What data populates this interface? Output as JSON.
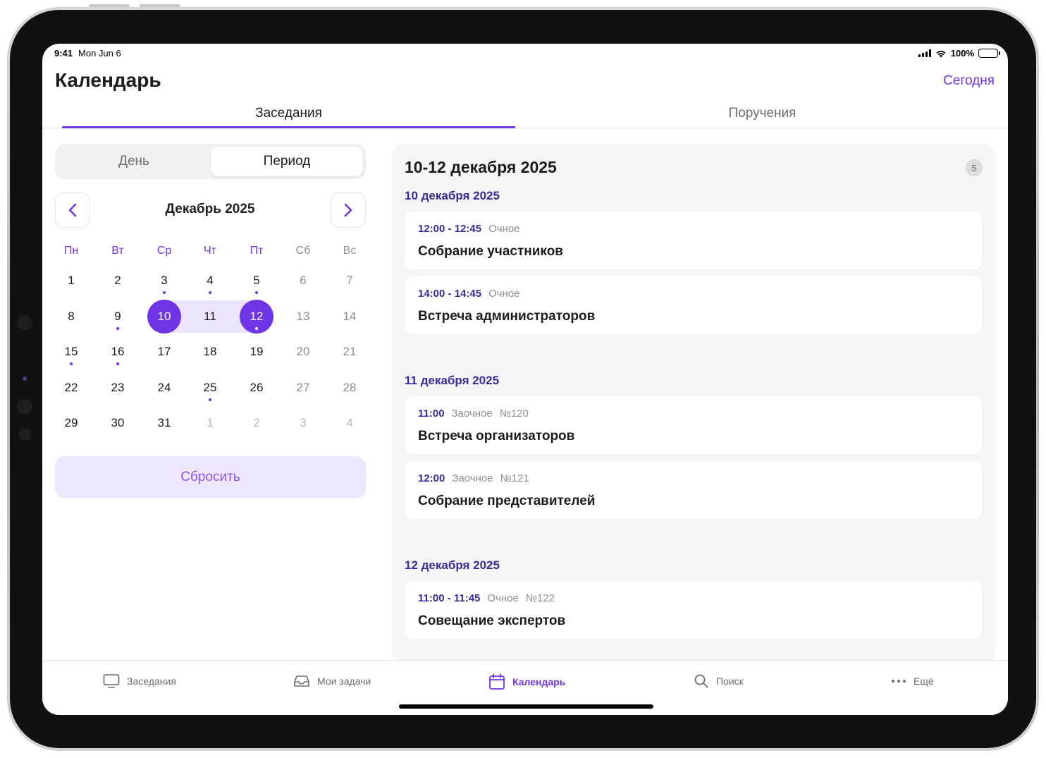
{
  "status_bar": {
    "time": "9:41",
    "date": "Mon Jun 6",
    "battery": "100%"
  },
  "header": {
    "title": "Календарь",
    "today_label": "Сегодня"
  },
  "tabs": [
    {
      "label": "Заседания",
      "active": true
    },
    {
      "label": "Поручения",
      "active": false
    }
  ],
  "segment": {
    "day_label": "День",
    "period_label": "Период",
    "selected": "Период"
  },
  "calendar": {
    "month_title": "Декабрь 2025",
    "weekdays": [
      "Пн",
      "Вт",
      "Ср",
      "Чт",
      "Пт",
      "Сб",
      "Вс"
    ],
    "weeks": [
      [
        {
          "d": "1"
        },
        {
          "d": "2"
        },
        {
          "d": "3",
          "dot": true
        },
        {
          "d": "4",
          "dot": true
        },
        {
          "d": "5",
          "dot": true
        },
        {
          "d": "6"
        },
        {
          "d": "7"
        }
      ],
      [
        {
          "d": "8"
        },
        {
          "d": "9",
          "dot": true
        },
        {
          "d": "10",
          "sel": true
        },
        {
          "d": "11",
          "range": true
        },
        {
          "d": "12",
          "sel": true,
          "dot": true
        },
        {
          "d": "13"
        },
        {
          "d": "14"
        }
      ],
      [
        {
          "d": "15",
          "dot": true
        },
        {
          "d": "16",
          "dot": true
        },
        {
          "d": "17"
        },
        {
          "d": "18"
        },
        {
          "d": "19"
        },
        {
          "d": "20"
        },
        {
          "d": "21"
        }
      ],
      [
        {
          "d": "22"
        },
        {
          "d": "23"
        },
        {
          "d": "24"
        },
        {
          "d": "25",
          "dot": true
        },
        {
          "d": "26"
        },
        {
          "d": "27"
        },
        {
          "d": "28"
        }
      ],
      [
        {
          "d": "29"
        },
        {
          "d": "30"
        },
        {
          "d": "31"
        },
        {
          "d": "1",
          "other": true
        },
        {
          "d": "2",
          "other": true
        },
        {
          "d": "3",
          "other": true
        },
        {
          "d": "4",
          "other": true
        }
      ]
    ],
    "reset_label": "Сбросить"
  },
  "agenda": {
    "range_title": "10-12 декабря 2025",
    "count": "5",
    "groups": [
      {
        "date": "10 декабря 2025",
        "items": [
          {
            "time": "12:00 - 12:45",
            "type": "Очное",
            "number": "",
            "title": "Собрание участников"
          },
          {
            "time": "14:00 - 14:45",
            "type": "Очное",
            "number": "",
            "title": "Встреча администраторов"
          }
        ]
      },
      {
        "date": "11 декабря 2025",
        "items": [
          {
            "time": "11:00",
            "type": "Заочное",
            "number": "№120",
            "title": "Встреча организаторов"
          },
          {
            "time": "12:00",
            "type": "Заочное",
            "number": "№121",
            "title": "Собрание представителей"
          }
        ]
      },
      {
        "date": "12 декабря 2025",
        "items": [
          {
            "time": "11:00 - 11:45",
            "type": "Очное",
            "number": "№122",
            "title": "Совещание экспертов"
          }
        ]
      }
    ]
  },
  "tabbar": {
    "items": [
      {
        "label": "Заседания",
        "icon": "monitor-icon",
        "active": false
      },
      {
        "label": "Мои задачи",
        "icon": "inbox-icon",
        "active": false
      },
      {
        "label": "Календарь",
        "icon": "calendar-icon",
        "active": true
      },
      {
        "label": "Поиск",
        "icon": "search-icon",
        "active": false
      },
      {
        "label": "Ещё",
        "icon": "more-icon",
        "active": false
      }
    ]
  },
  "colors": {
    "accent": "#6e34e6",
    "accent_dark": "#3a2a9a",
    "range_fill": "#ece4fd",
    "reset_bg": "#efe7fd"
  }
}
